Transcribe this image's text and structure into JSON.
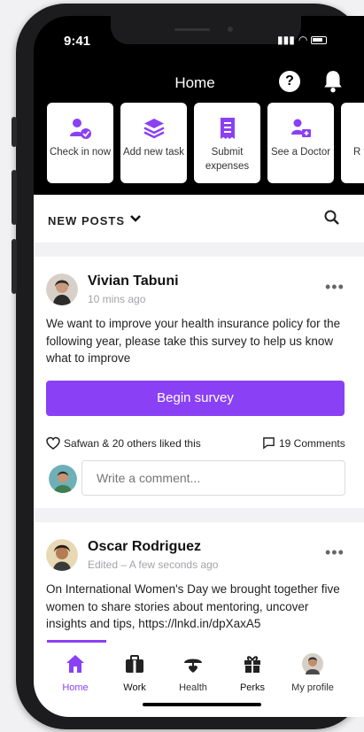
{
  "status_bar": {
    "time": "9:41"
  },
  "header": {
    "title": "Home",
    "help_label": "?"
  },
  "quick_actions": [
    {
      "label": "Check in now",
      "icon": "check-in-icon"
    },
    {
      "label": "Add new task",
      "icon": "layers-icon"
    },
    {
      "label": "Submit expenses",
      "icon": "receipt-icon"
    },
    {
      "label": "See a Doctor",
      "icon": "doctor-icon"
    },
    {
      "label": "R t",
      "icon": "partial-icon"
    }
  ],
  "feed": {
    "section_label": "NEW POSTS"
  },
  "posts": [
    {
      "author": "Vivian Tabuni",
      "time": "10 mins ago",
      "body": "We want to improve your health insurance policy for the following year, please take this survey to help us know what to improve",
      "action_label": "Begin survey",
      "likes_text": "Safwan & 20 others liked this",
      "comments_text": "19 Comments",
      "comment_placeholder": "Write a comment..."
    },
    {
      "author": "Oscar Rodriguez",
      "time": "Edited – A few seconds ago",
      "body": "On International Women's Day we brought together five women to share stories about mentoring, uncover insights and tips, https://lnkd.in/dpXaxA5"
    }
  ],
  "tabs": [
    {
      "label": "Home",
      "icon": "home-icon",
      "active": true
    },
    {
      "label": "Work",
      "icon": "briefcase-icon",
      "active": false
    },
    {
      "label": "Health",
      "icon": "health-icon",
      "active": false
    },
    {
      "label": "Perks",
      "icon": "gift-icon",
      "active": false
    },
    {
      "label": "My profile",
      "icon": "profile-avatar-icon",
      "active": false
    }
  ],
  "colors": {
    "accent": "#8a40f5",
    "background": "#000000",
    "feed_bg": "#f2f2f4"
  }
}
